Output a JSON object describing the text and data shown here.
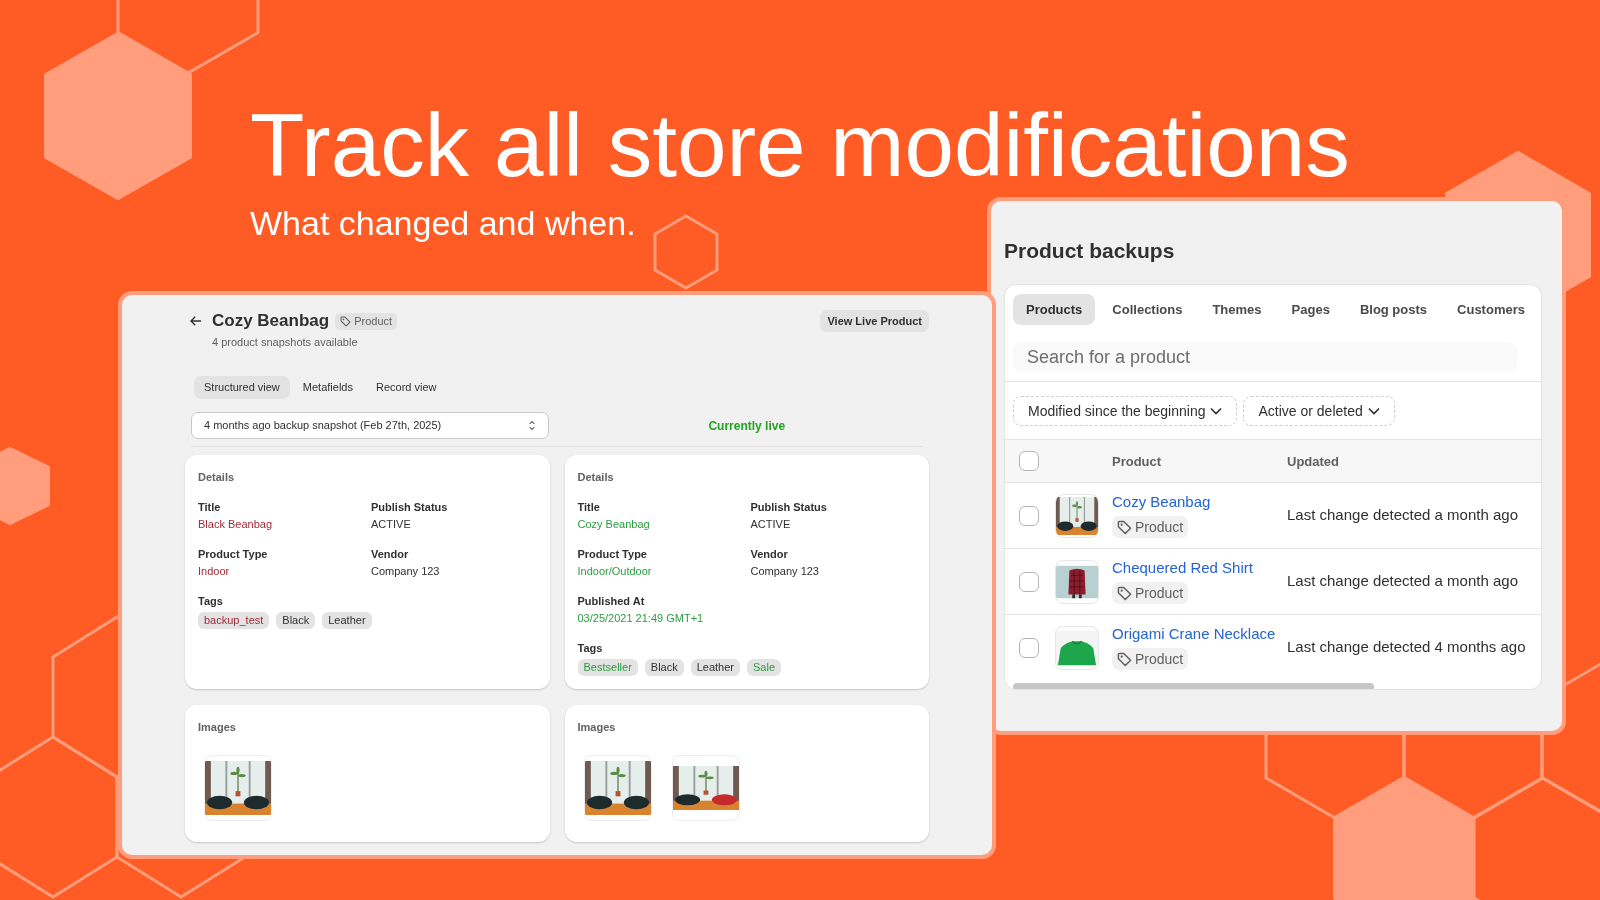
{
  "hero": {
    "title": "Track all store modifications",
    "subtitle": "What changed and when."
  },
  "product_view": {
    "title": "Cozy Beanbag",
    "badge": "Product",
    "subtitle": "4 product snapshots available",
    "action": "View Live Product",
    "tabs": [
      {
        "label": "Structured view",
        "selected": true
      },
      {
        "label": "Metafields",
        "selected": false
      },
      {
        "label": "Record view",
        "selected": false
      }
    ],
    "snapshot_select": {
      "value": "4 months ago backup snapshot (Feb 27th, 2025)"
    },
    "live_label": "Currently live",
    "versions": [
      {
        "details": {
          "heading": "Details",
          "fields": [
            {
              "label": "Title",
              "value": "Black Beanbag",
              "color": "#9e2a38"
            },
            {
              "label": "Publish Status",
              "value": "ACTIVE",
              "color": "#303030"
            },
            {
              "label": "Product Type",
              "value": "Indoor",
              "color": "#9e2a38"
            },
            {
              "label": "Vendor",
              "value": "Company 123",
              "color": "#303030"
            }
          ],
          "tags_label": "Tags",
          "tags": [
            {
              "label": "backup_test",
              "color": "#9e2a38"
            },
            {
              "label": "Black",
              "color": "#303030"
            },
            {
              "label": "Leather",
              "color": "#303030"
            }
          ]
        },
        "images": {
          "heading": "Images",
          "items": [
            {
              "kind": "dark"
            }
          ]
        }
      },
      {
        "details": {
          "heading": "Details",
          "fields": [
            {
              "label": "Title",
              "value": "Cozy Beanbag",
              "color": "#2c9c3f"
            },
            {
              "label": "Publish Status",
              "value": "ACTIVE",
              "color": "#303030"
            },
            {
              "label": "Product Type",
              "value": "Indoor/Outdoor",
              "color": "#2c9c3f"
            },
            {
              "label": "Vendor",
              "value": "Company 123",
              "color": "#303030"
            },
            {
              "label": "Published At",
              "value": "03/25/2021 21:49 GMT+1",
              "color": "#2c9c3f"
            }
          ],
          "tags_label": "Tags",
          "tags": [
            {
              "label": "Bestseller",
              "color": "#2c9c3f"
            },
            {
              "label": "Black",
              "color": "#303030"
            },
            {
              "label": "Leather",
              "color": "#303030"
            },
            {
              "label": "Sale",
              "color": "#2c9c3f"
            }
          ]
        },
        "images": {
          "heading": "Images",
          "items": [
            {
              "kind": "dark"
            },
            {
              "kind": "red"
            }
          ]
        }
      }
    ]
  },
  "backups": {
    "title": "Product backups",
    "tabs": [
      {
        "label": "Products",
        "selected": true
      },
      {
        "label": "Collections",
        "selected": false
      },
      {
        "label": "Themes",
        "selected": false
      },
      {
        "label": "Pages",
        "selected": false
      },
      {
        "label": "Blog posts",
        "selected": false
      },
      {
        "label": "Customers",
        "selected": false
      }
    ],
    "search": {
      "placeholder": "Search for a product"
    },
    "filters": [
      {
        "label": "Modified since the beginning"
      },
      {
        "label": "Active or deleted"
      }
    ],
    "table": {
      "select_all": {
        "checked": false
      },
      "columns": [
        "Product",
        "Updated"
      ],
      "rows": [
        {
          "checked": false,
          "thumbnail": {
            "kind": "room"
          },
          "name": "Cozy Beanbag",
          "badge": "Product",
          "updated": "Last change detected a month ago"
        },
        {
          "checked": false,
          "thumbnail": {
            "kind": "shirt"
          },
          "name": "Chequered Red Shirt",
          "badge": "Product",
          "updated": "Last change detected a month ago"
        },
        {
          "checked": false,
          "thumbnail": {
            "kind": "sweater"
          },
          "name": "Origami Crane Necklace",
          "badge": "Product",
          "updated": "Last change detected 4 months ago"
        }
      ]
    }
  }
}
